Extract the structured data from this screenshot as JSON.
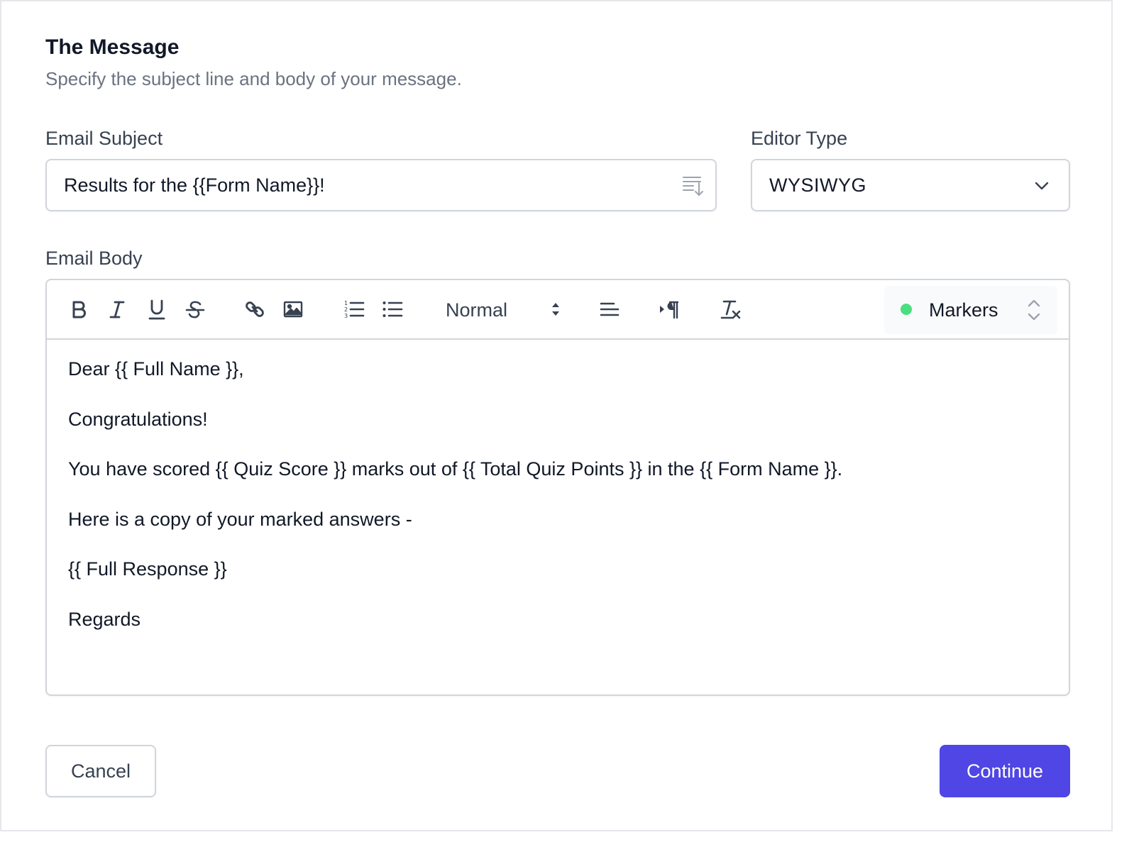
{
  "section": {
    "title": "The Message",
    "subtitle": "Specify the subject line and body of your message."
  },
  "subject": {
    "label": "Email Subject",
    "value": "Results for the {{Form Name}}!",
    "icon": "insert-field-icon"
  },
  "editor_type": {
    "label": "Editor Type",
    "value": "WYSIWYG",
    "icon": "chevron-down-icon"
  },
  "body": {
    "label": "Email Body",
    "toolbar": {
      "tools": [
        "bold",
        "italic",
        "underline",
        "strikethrough",
        "link",
        "image",
        "ordered-list",
        "bullet-list",
        "align",
        "text-direction",
        "clear-formatting"
      ],
      "heading_value": "Normal",
      "markers_label": "Markers",
      "markers_status_color": "#4ade80"
    },
    "paragraphs": [
      "Dear {{ Full Name }},",
      "Congratulations!",
      "You have scored {{ Quiz Score }} marks out of {{ Total Quiz Points }} in the {{ Form Name }}.",
      "Here is a copy of your marked answers -",
      "{{ Full Response }}",
      "Regards"
    ]
  },
  "actions": {
    "cancel_label": "Cancel",
    "continue_label": "Continue",
    "continue_color": "#4f46e5"
  }
}
